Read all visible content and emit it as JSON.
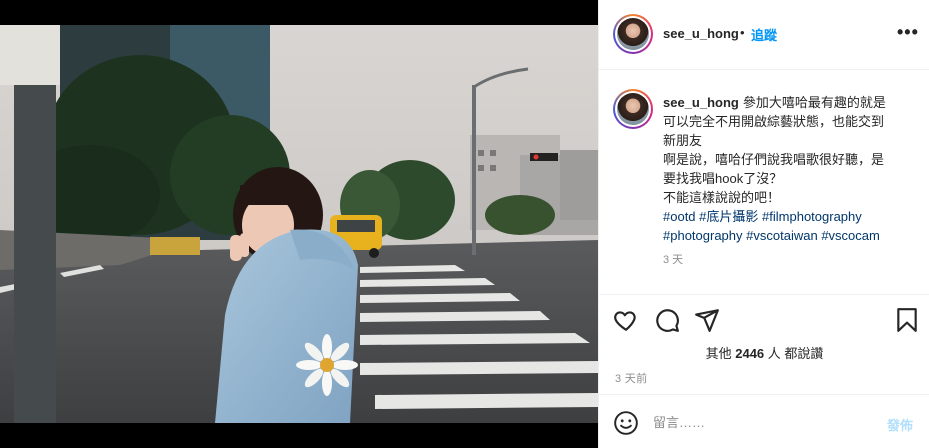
{
  "post": {
    "username": "see_u_hong",
    "follow_label": "追蹤",
    "dot": "•",
    "more_label": "•••",
    "caption": {
      "lines": [
        "參加大嘻哈最有趣的就是",
        "可以完全不用開啟綜藝狀態，也能交到",
        "新朋友",
        "啊是說，嘻哈仔們說我唱歌很好聽，是",
        "要找我唱hook了沒？",
        "不能這樣說說的吧！"
      ],
      "tags_line1": [
        "#ootd",
        "#底片攝影",
        "#filmphotography"
      ],
      "tags_line2": [
        "#photography",
        "#vscotaiwan",
        "#vscocam"
      ]
    },
    "caption_time": "3 天",
    "likes_prefix": "其他",
    "likes_count": "2446",
    "likes_suffix": "人 都說讚",
    "post_time": "3 天前",
    "comment_placeholder": "留言……",
    "post_button": "發佈",
    "icons": {
      "like": "heart-icon",
      "comment": "comment-icon",
      "share": "share-icon",
      "save": "bookmark-icon",
      "emoji": "emoji-icon"
    },
    "colors": {
      "accent": "#0095f6",
      "post_disabled": "#b2dffc",
      "hashtag": "#00376b",
      "muted": "#8e8e8e"
    }
  }
}
